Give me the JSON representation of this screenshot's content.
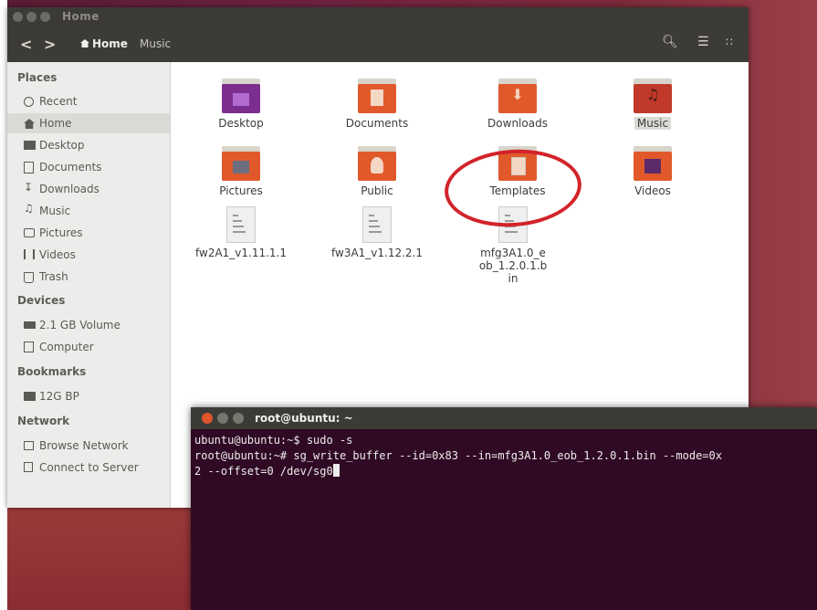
{
  "window": {
    "title": "Home"
  },
  "toolbar": {
    "back": "<",
    "forward": ">",
    "breadcrumbs": [
      "Home",
      "Music"
    ]
  },
  "sidebar": {
    "sections": [
      {
        "heading": "Places",
        "items": [
          "Recent",
          "Home",
          "Desktop",
          "Documents",
          "Downloads",
          "Music",
          "Pictures",
          "Videos",
          "Trash"
        ]
      },
      {
        "heading": "Devices",
        "items": [
          "2.1 GB Volume",
          "Computer"
        ]
      },
      {
        "heading": "Bookmarks",
        "items": [
          "12G BP"
        ]
      },
      {
        "heading": "Network",
        "items": [
          "Browse Network",
          "Connect to Server"
        ]
      }
    ]
  },
  "files": [
    {
      "name": "Desktop",
      "icon": "desktop-folder-icon"
    },
    {
      "name": "Documents",
      "icon": "documents-folder-icon"
    },
    {
      "name": "Downloads",
      "icon": "downloads-folder-icon"
    },
    {
      "name": "Music",
      "icon": "music-folder-icon"
    },
    {
      "name": "Pictures",
      "icon": "pictures-folder-icon"
    },
    {
      "name": "Public",
      "icon": "public-folder-icon"
    },
    {
      "name": "Templates",
      "icon": "templates-folder-icon"
    },
    {
      "name": "Videos",
      "icon": "videos-folder-icon"
    },
    {
      "name": "fw2A1_v1.11.1.1",
      "icon": "text-file-icon"
    },
    {
      "name": "fw3A1_v1.12.2.1",
      "icon": "text-file-icon"
    },
    {
      "name": "mfg3A1.0_eob_1.2.0.1.bin",
      "icon": "text-file-icon"
    }
  ],
  "terminal": {
    "title": "root@ubuntu: ~",
    "lines": [
      "ubuntu@ubuntu:~$ sudo -s",
      "root@ubuntu:~# sg_write_buffer --id=0x83 --in=mfg3A1.0_eob_1.2.0.1.bin --mode=0x",
      "2 --offset=0 /dev/sg0"
    ]
  },
  "colors": {
    "folder_orange": "#e1592a",
    "terminal_bg": "#300a24",
    "annotation_red": "#d2232a"
  }
}
